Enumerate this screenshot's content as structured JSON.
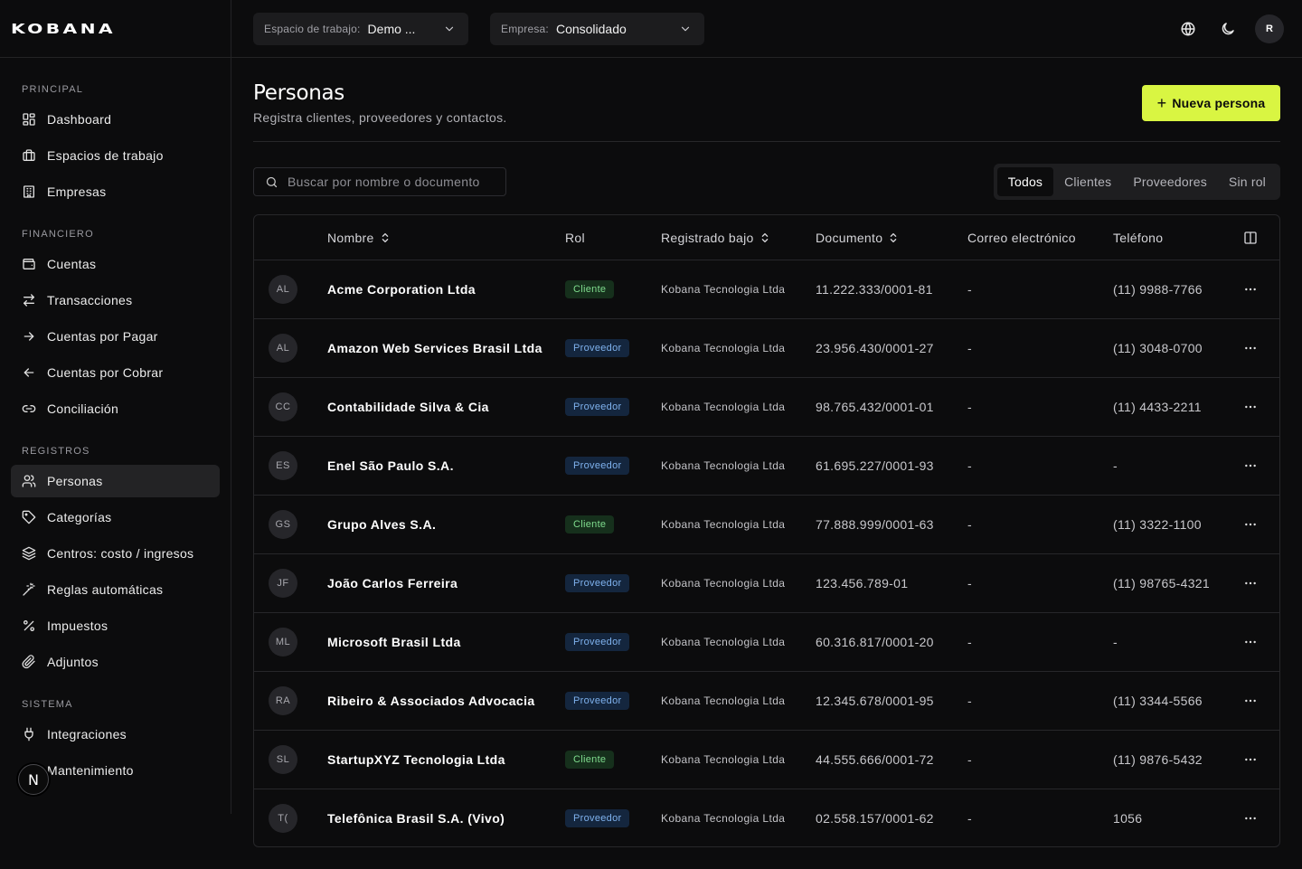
{
  "brand": {
    "logo": "KOBANA"
  },
  "topbar": {
    "workspace": {
      "label": "Espacio de trabajo:",
      "value": "Demo ..."
    },
    "company": {
      "label": "Empresa:",
      "value": "Consolidado"
    },
    "avatar": "R"
  },
  "sidebar": {
    "sections": [
      {
        "title": "PRINCIPAL",
        "items": [
          {
            "label": "Dashboard",
            "icon": "dashboard-icon"
          },
          {
            "label": "Espacios de trabajo",
            "icon": "briefcase-icon"
          },
          {
            "label": "Empresas",
            "icon": "building-icon"
          }
        ]
      },
      {
        "title": "FINANCIERO",
        "items": [
          {
            "label": "Cuentas",
            "icon": "wallet-icon"
          },
          {
            "label": "Transacciones",
            "icon": "arrows-exchange-icon"
          },
          {
            "label": "Cuentas por Pagar",
            "icon": "arrow-right-icon"
          },
          {
            "label": "Cuentas por Cobrar",
            "icon": "arrow-left-icon"
          },
          {
            "label": "Conciliación",
            "icon": "link-icon"
          }
        ]
      },
      {
        "title": "REGISTROS",
        "items": [
          {
            "label": "Personas",
            "icon": "users-icon"
          },
          {
            "label": "Categorías",
            "icon": "tag-icon"
          },
          {
            "label": "Centros: costo / ingresos",
            "icon": "layers-icon"
          },
          {
            "label": "Reglas automáticas",
            "icon": "wand-icon"
          },
          {
            "label": "Impuestos",
            "icon": "percent-icon"
          },
          {
            "label": "Adjuntos",
            "icon": "paperclip-icon"
          }
        ]
      },
      {
        "title": "SISTEMA",
        "items": [
          {
            "label": "Integraciones",
            "icon": "plug-icon"
          },
          {
            "label": "Mantenimiento",
            "icon": "wrench-icon"
          }
        ]
      }
    ],
    "active": "Personas",
    "floating_badge": "N"
  },
  "page": {
    "title": "Personas",
    "subtitle": "Registra clientes, proveedores y contactos.",
    "new_button": "Nueva persona",
    "search_placeholder": "Buscar por nombre o documento",
    "tabs": [
      "Todos",
      "Clientes",
      "Proveedores",
      "Sin rol"
    ],
    "active_tab": "Todos"
  },
  "table": {
    "columns": [
      "Nombre",
      "Rol",
      "Registrado bajo",
      "Documento",
      "Correo electrónico",
      "Teléfono"
    ],
    "rows": [
      {
        "initials": "AL",
        "name": "Acme Corporation Ltda",
        "role": "Cliente",
        "registered": "Kobana Tecnologia Ltda",
        "document": "11.222.333/0001-81",
        "email": "-",
        "phone": "(11) 9988-7766"
      },
      {
        "initials": "AL",
        "name": "Amazon Web Services Brasil Ltda",
        "role": "Proveedor",
        "registered": "Kobana Tecnologia Ltda",
        "document": "23.956.430/0001-27",
        "email": "-",
        "phone": "(11) 3048-0700"
      },
      {
        "initials": "CC",
        "name": "Contabilidade Silva & Cia",
        "role": "Proveedor",
        "registered": "Kobana Tecnologia Ltda",
        "document": "98.765.432/0001-01",
        "email": "-",
        "phone": "(11) 4433-2211"
      },
      {
        "initials": "ES",
        "name": "Enel São Paulo S.A.",
        "role": "Proveedor",
        "registered": "Kobana Tecnologia Ltda",
        "document": "61.695.227/0001-93",
        "email": "-",
        "phone": "-"
      },
      {
        "initials": "GS",
        "name": "Grupo Alves S.A.",
        "role": "Cliente",
        "registered": "Kobana Tecnologia Ltda",
        "document": "77.888.999/0001-63",
        "email": "-",
        "phone": "(11) 3322-1100"
      },
      {
        "initials": "JF",
        "name": "João Carlos Ferreira",
        "role": "Proveedor",
        "registered": "Kobana Tecnologia Ltda",
        "document": "123.456.789-01",
        "email": "-",
        "phone": "(11) 98765-4321"
      },
      {
        "initials": "ML",
        "name": "Microsoft Brasil Ltda",
        "role": "Proveedor",
        "registered": "Kobana Tecnologia Ltda",
        "document": "60.316.817/0001-20",
        "email": "-",
        "phone": "-"
      },
      {
        "initials": "RA",
        "name": "Ribeiro & Associados Advocacia",
        "role": "Proveedor",
        "registered": "Kobana Tecnologia Ltda",
        "document": "12.345.678/0001-95",
        "email": "-",
        "phone": "(11) 3344-5566"
      },
      {
        "initials": "SL",
        "name": "StartupXYZ Tecnologia Ltda",
        "role": "Cliente",
        "registered": "Kobana Tecnologia Ltda",
        "document": "44.555.666/0001-72",
        "email": "-",
        "phone": "(11) 9876-5432"
      },
      {
        "initials": "T(",
        "name": "Telefônica Brasil S.A. (Vivo)",
        "role": "Proveedor",
        "registered": "Kobana Tecnologia Ltda",
        "document": "02.558.157/0001-62",
        "email": "-",
        "phone": "1056"
      }
    ]
  }
}
